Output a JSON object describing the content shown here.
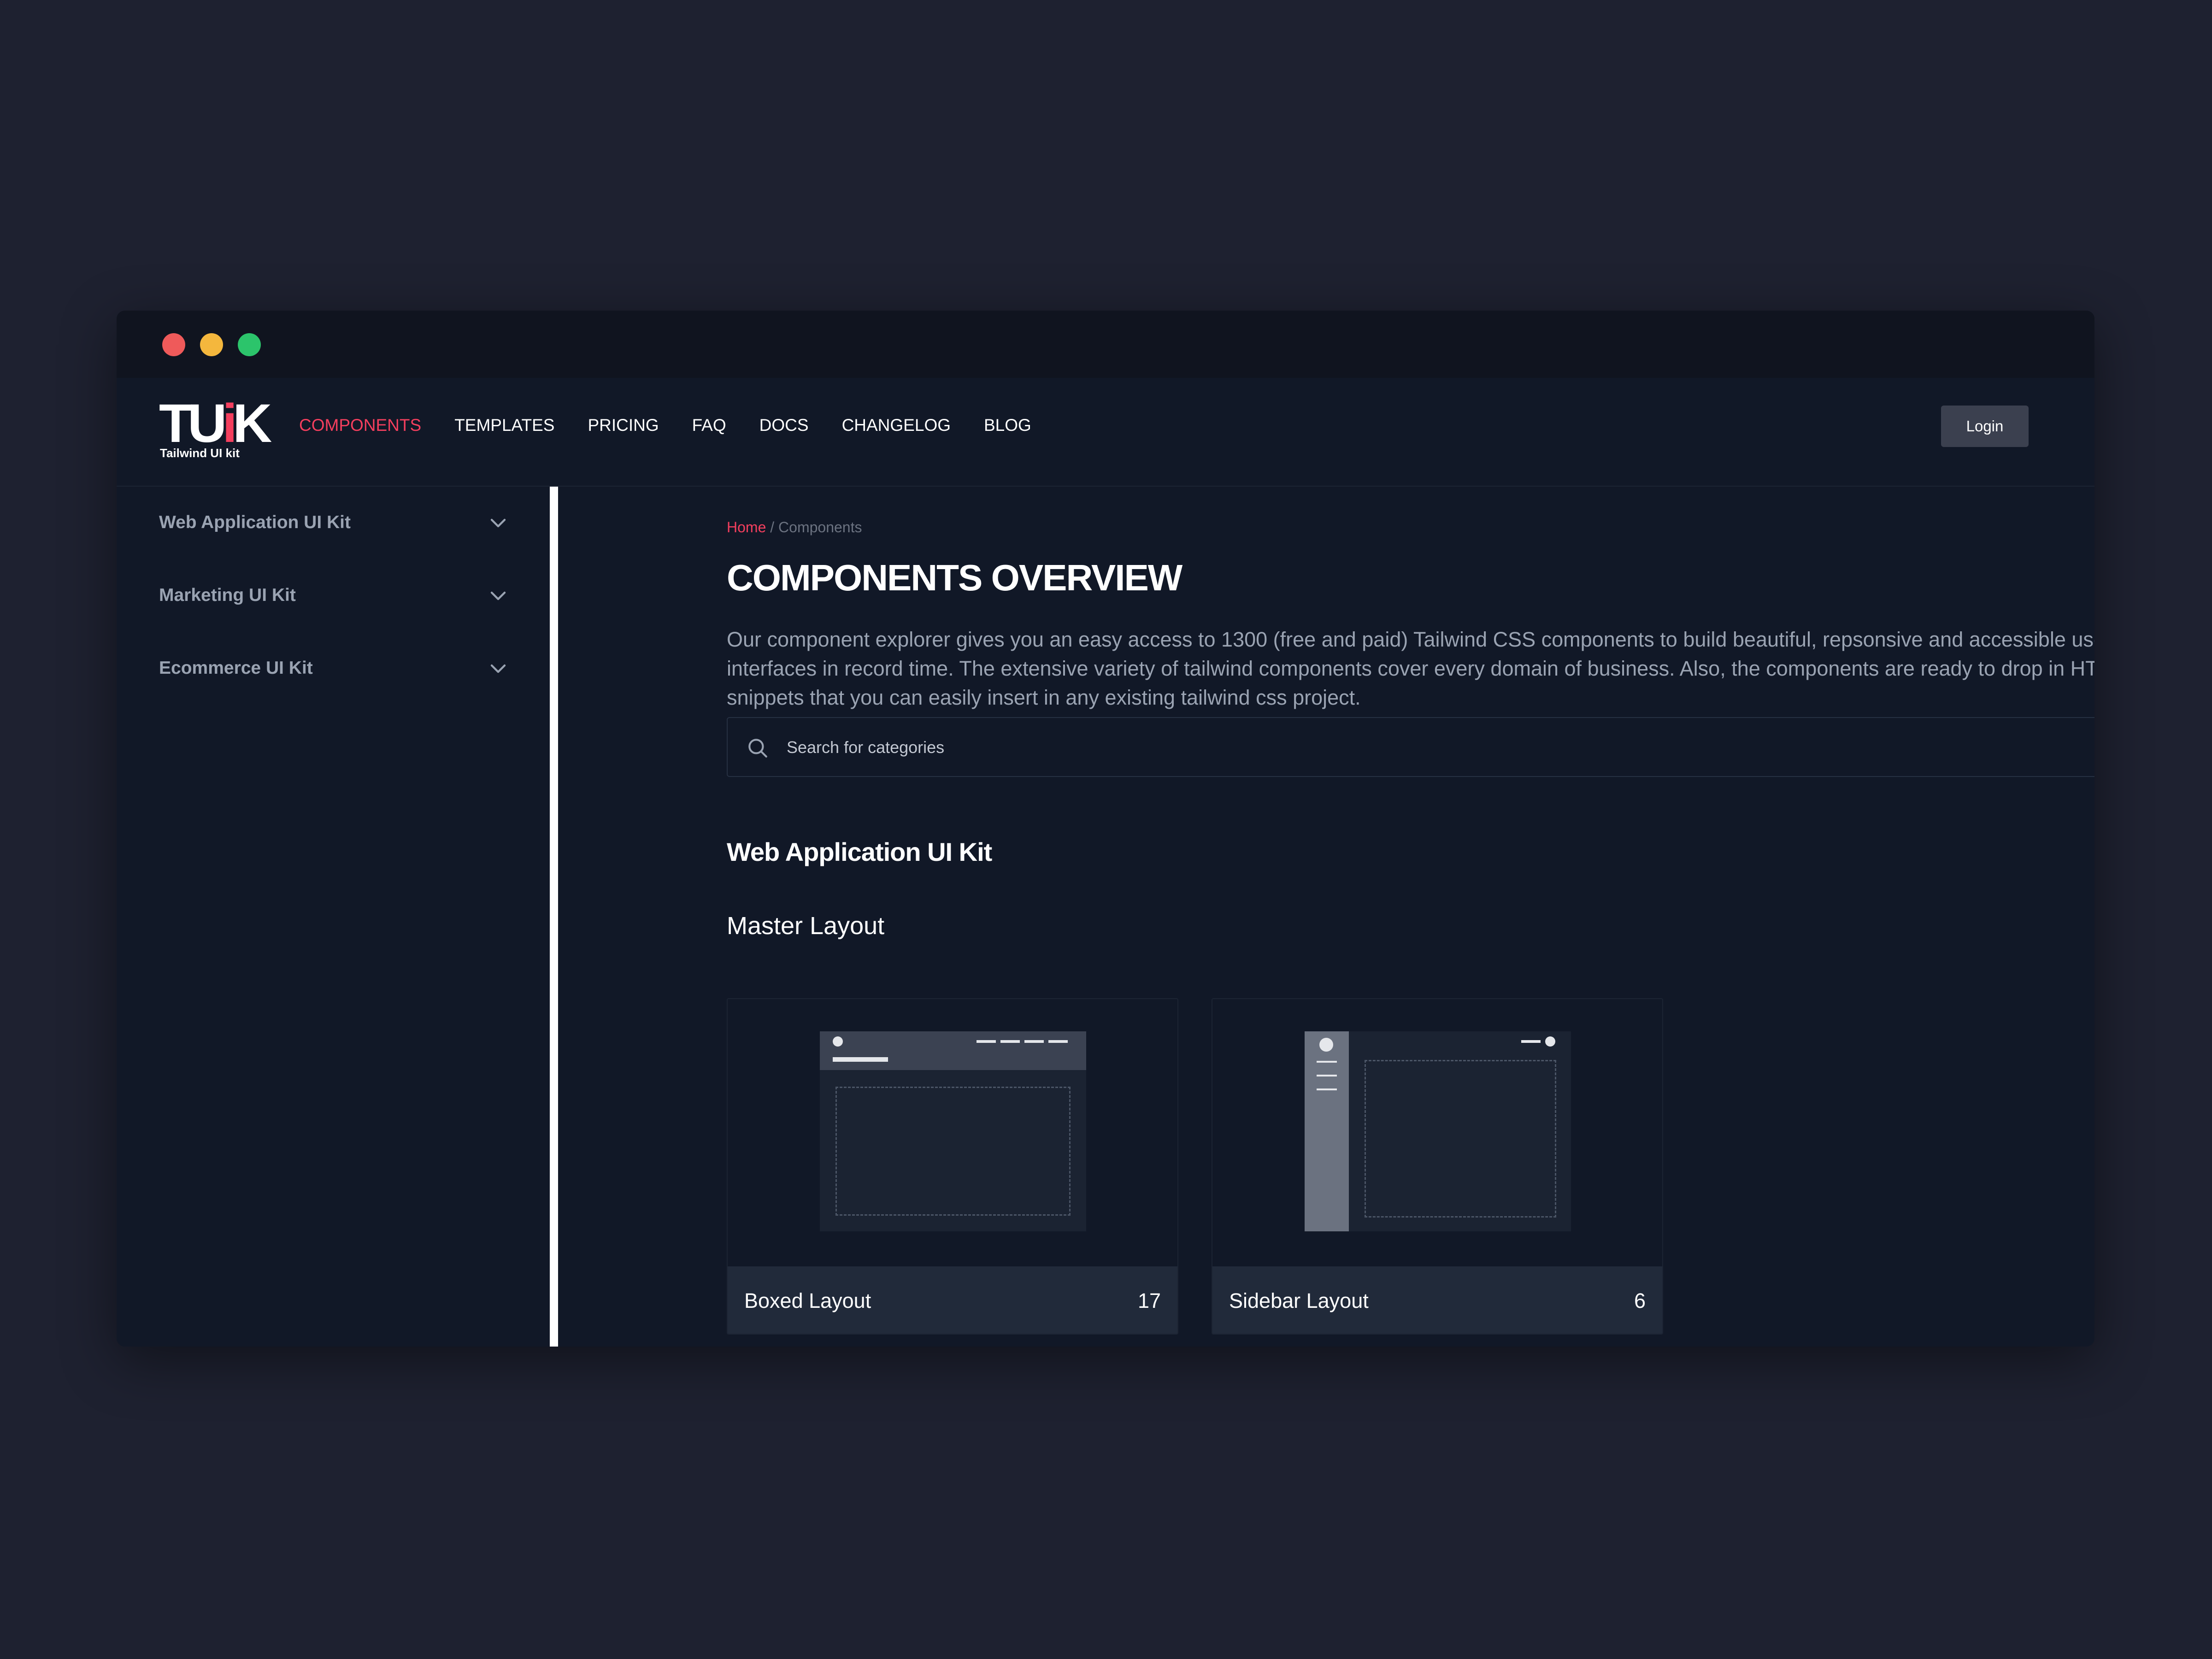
{
  "nav": {
    "logo_mark": "TUiK",
    "logo_sub": "Tailwind UI kit",
    "links": [
      {
        "label": "COMPONENTS"
      },
      {
        "label": "TEMPLATES"
      },
      {
        "label": "PRICING"
      },
      {
        "label": "FAQ"
      },
      {
        "label": "DOCS"
      },
      {
        "label": "CHANGELOG"
      },
      {
        "label": "BLOG"
      }
    ],
    "login_label": "Login"
  },
  "sidebar": {
    "items": [
      {
        "label": "Web Application UI Kit"
      },
      {
        "label": "Marketing UI Kit"
      },
      {
        "label": "Ecommerce UI Kit"
      }
    ]
  },
  "main": {
    "breadcrumb": {
      "home": "Home",
      "separator": "/",
      "current": "Components"
    },
    "title": "COMPONENTS OVERVIEW",
    "intro": "Our component explorer gives you an easy access to 1300 (free and paid) Tailwind CSS components to build beautiful, repsonsive and accessible user interfaces in record time. The extensive variety of tailwind components cover every domain of business. Also, the components are ready to drop in HTML snippets that you can easily insert in any existing tailwind css project.",
    "search": {
      "placeholder": "Search for categories",
      "value": ""
    },
    "section_title": "Web Application UI Kit",
    "subsection_title": "Master Layout",
    "cards": [
      {
        "name": "Boxed Layout",
        "count": "17"
      },
      {
        "name": "Sidebar Layout",
        "count": "6"
      }
    ]
  },
  "colors": {
    "background": "#1e2130",
    "window": "#111827",
    "accent": "#f43f5e",
    "muted_text": "#9aa3b2",
    "card_footer": "#212a3a",
    "traffic_red": "#ef5a5a",
    "traffic_yellow": "#f4b73d",
    "traffic_green": "#2cc46b"
  },
  "icons": {
    "search": "search-icon",
    "chevron": "chevron-down-icon"
  }
}
